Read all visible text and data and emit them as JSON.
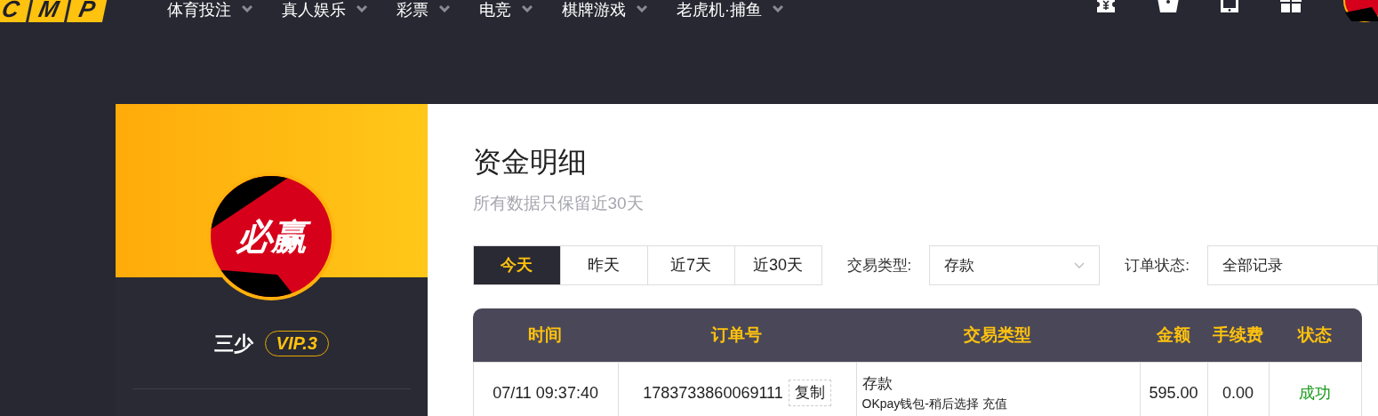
{
  "header": {
    "logo": [
      "C",
      "M",
      "P"
    ],
    "nav": [
      {
        "label": "体育投注"
      },
      {
        "label": "真人娱乐"
      },
      {
        "label": "彩票"
      },
      {
        "label": "电竞"
      },
      {
        "label": "棋牌游戏"
      },
      {
        "label": "老虎机·捕鱼"
      }
    ]
  },
  "profile": {
    "avatar_text": "必赢",
    "name": "三少",
    "vip": "VIP.3"
  },
  "page": {
    "title": "资金明细",
    "subtitle": "所有数据只保留近30天",
    "date_tabs": [
      {
        "label": "今天",
        "selected": true
      },
      {
        "label": "昨天",
        "selected": false
      },
      {
        "label": "近7天",
        "selected": false
      },
      {
        "label": "近30天",
        "selected": false
      }
    ],
    "filters": [
      {
        "label": "交易类型:",
        "value": "存款",
        "kind": "dropdown"
      },
      {
        "label": "订单状态:",
        "value": "全部记录",
        "kind": "plain"
      }
    ]
  },
  "table": {
    "columns": [
      "时间",
      "订单号",
      "交易类型",
      "金额",
      "手续费",
      "状态"
    ],
    "rows": [
      {
        "time": "07/11 09:37:40",
        "order": "1783733860069111",
        "copy": "复制",
        "type": "存款",
        "detail": "OKpay钱包-稍后选择 充值",
        "amount": "595.00",
        "fee": "0.00",
        "status": "成功",
        "color": "#1a9a1a"
      }
    ]
  }
}
